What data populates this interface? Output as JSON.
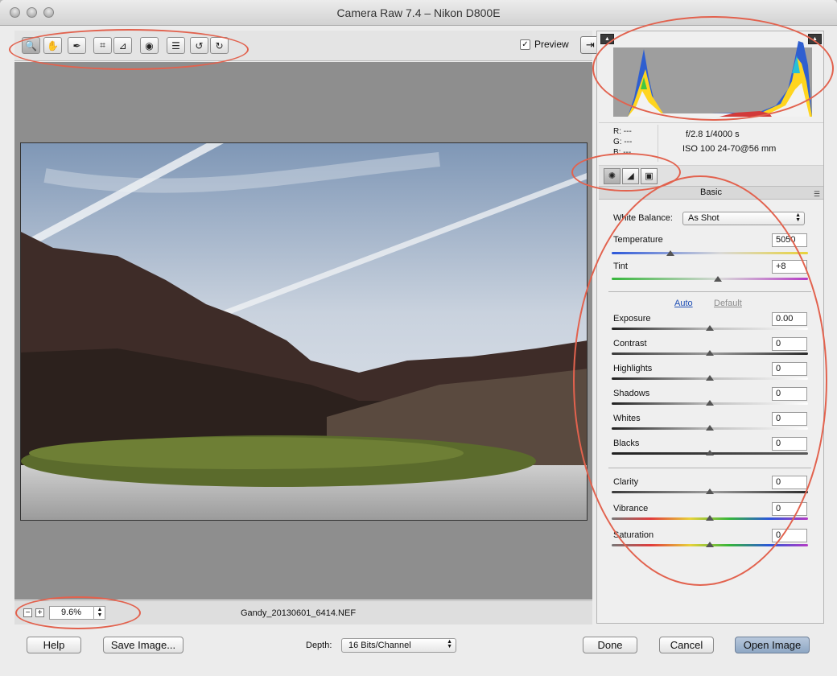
{
  "window": {
    "title": "Camera Raw 7.4  –  Nikon D800E"
  },
  "toolbar": {
    "tools": [
      {
        "id": "zoom-tool",
        "icon": "magnifier-icon",
        "glyph": "🔍"
      },
      {
        "id": "hand-tool",
        "icon": "hand-icon",
        "glyph": "✋"
      },
      {
        "id": "white-balance-tool",
        "icon": "eyedropper-icon",
        "glyph": "✒"
      },
      {
        "id": "crop-tool",
        "icon": "crop-icon",
        "glyph": "⌗"
      },
      {
        "id": "straighten-tool",
        "icon": "straighten-icon",
        "glyph": "⊿"
      },
      {
        "id": "red-eye-tool",
        "icon": "red-eye-icon",
        "glyph": "◉"
      },
      {
        "id": "preferences-tool",
        "icon": "list-icon",
        "glyph": "☰"
      },
      {
        "id": "rotate-ccw-tool",
        "icon": "rotate-ccw-icon",
        "glyph": "↺"
      },
      {
        "id": "rotate-cw-tool",
        "icon": "rotate-cw-icon",
        "glyph": "↻"
      }
    ],
    "preview_label": "Preview",
    "preview_checked": true
  },
  "status": {
    "zoom": "9.6%",
    "filename": "Gandy_20130601_6414.NEF"
  },
  "info": {
    "r": "R:  ---",
    "g": "G:  ---",
    "b": "B:  ---",
    "exposure": "f/2.8    1/4000 s",
    "lens": "ISO 100    24-70@56 mm"
  },
  "panel": {
    "section_title": "Basic",
    "white_balance_label": "White Balance:",
    "white_balance_value": "As Shot",
    "temperature": {
      "label": "Temperature",
      "value": "5050",
      "fraction": 0.3
    },
    "tint": {
      "label": "Tint",
      "value": "+8",
      "fraction": 0.54
    },
    "auto_label": "Auto",
    "default_label": "Default",
    "sliders": [
      {
        "key": "exposure",
        "label": "Exposure",
        "value": "0.00",
        "fraction": 0.5
      },
      {
        "key": "contrast",
        "label": "Contrast",
        "value": "0",
        "fraction": 0.5
      },
      {
        "key": "highlights",
        "label": "Highlights",
        "value": "0",
        "fraction": 0.5
      },
      {
        "key": "shadows",
        "label": "Shadows",
        "value": "0",
        "fraction": 0.5
      },
      {
        "key": "whites",
        "label": "Whites",
        "value": "0",
        "fraction": 0.5
      },
      {
        "key": "blacks",
        "label": "Blacks",
        "value": "0",
        "fraction": 0.5
      }
    ],
    "presence": [
      {
        "key": "clarity",
        "label": "Clarity",
        "value": "0",
        "fraction": 0.5
      },
      {
        "key": "vibrance",
        "label": "Vibrance",
        "value": "0",
        "fraction": 0.5
      },
      {
        "key": "saturation",
        "label": "Saturation",
        "value": "0",
        "fraction": 0.5
      }
    ]
  },
  "footer": {
    "help": "Help",
    "save_image": "Save Image...",
    "depth_label": "Depth:",
    "depth_value": "16 Bits/Channel",
    "done": "Done",
    "cancel": "Cancel",
    "open_image": "Open Image"
  },
  "colors": {
    "annotation": "#e2624e",
    "auto_link": "#1f4fb5",
    "default_link": "#8c8c8c"
  }
}
